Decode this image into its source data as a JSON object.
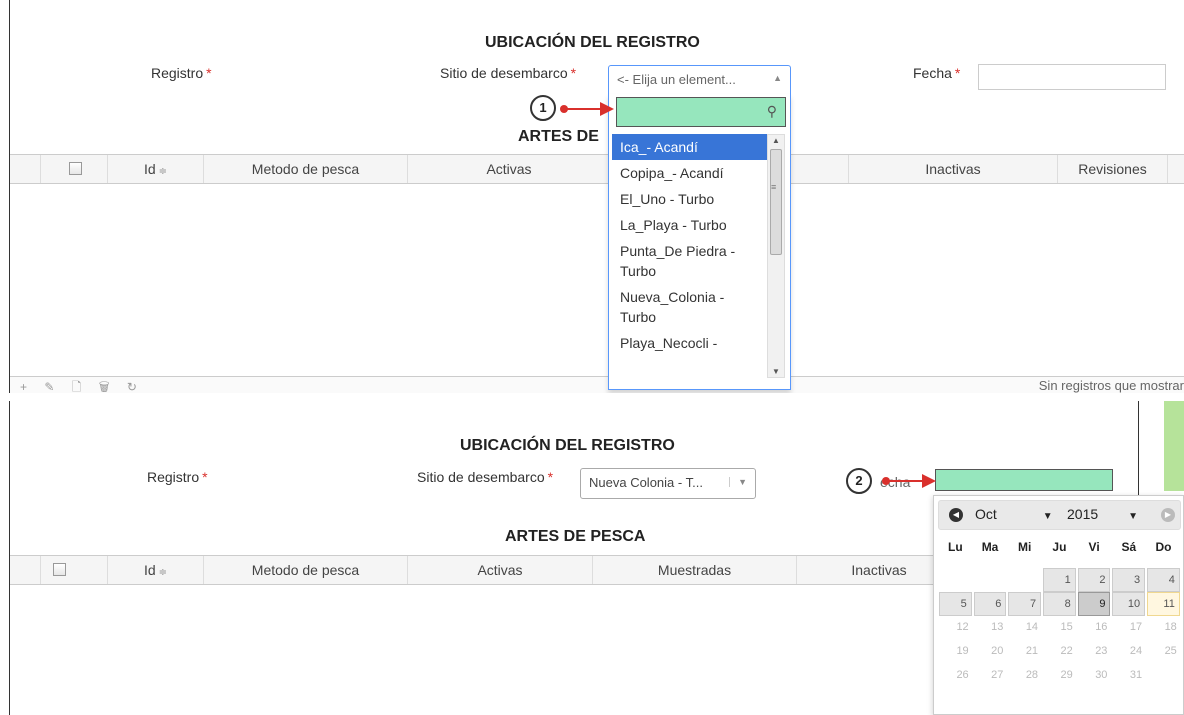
{
  "panel1": {
    "section_title": "UBICACIÓN DEL REGISTRO",
    "registro_label": "Registro",
    "sitio_label": "Sitio de desembarco",
    "fecha_label": "Fecha",
    "required_mark": "*",
    "sitio_placeholder": "<- Elija un element...",
    "artes_title": "ARTES DE",
    "callout": "1",
    "columns": [
      "Id",
      "Metodo de pesca",
      "Activas",
      "Inactivas",
      "Revisiones"
    ],
    "dropdown_items": [
      "Ica_- Acandí",
      "Copipa_- Acandí",
      "El_Uno - Turbo",
      "La_Playa - Turbo",
      "Punta_De Piedra - Turbo",
      "Nueva_Colonia - Turbo",
      "Playa_Necocli -"
    ],
    "pager_text": "Sin registros que mostrar"
  },
  "panel2": {
    "section_title": "UBICACIÓN DEL REGISTRO",
    "registro_label": "Registro",
    "sitio_label": "Sitio de desembarco",
    "sitio_value": "Nueva Colonia - T...",
    "fecha_label_partial": "echa",
    "required_mark": "*",
    "artes_title": "ARTES DE PESCA",
    "callout": "2",
    "columns": [
      "Id",
      "Metodo de pesca",
      "Activas",
      "Muestradas",
      "Inactivas"
    ],
    "datepicker": {
      "month": "Oct",
      "year": "2015",
      "weekdays": [
        "Lu",
        "Ma",
        "Mi",
        "Ju",
        "Vi",
        "Sá",
        "Do"
      ],
      "weeks": [
        [
          "",
          "",
          "",
          "1",
          "2",
          "3",
          "4"
        ],
        [
          "5",
          "6",
          "7",
          "8",
          "9",
          "10",
          "11"
        ],
        [
          "12",
          "13",
          "14",
          "15",
          "16",
          "17",
          "18"
        ],
        [
          "19",
          "20",
          "21",
          "22",
          "23",
          "24",
          "25"
        ],
        [
          "26",
          "27",
          "28",
          "29",
          "30",
          "31",
          ""
        ]
      ]
    }
  }
}
